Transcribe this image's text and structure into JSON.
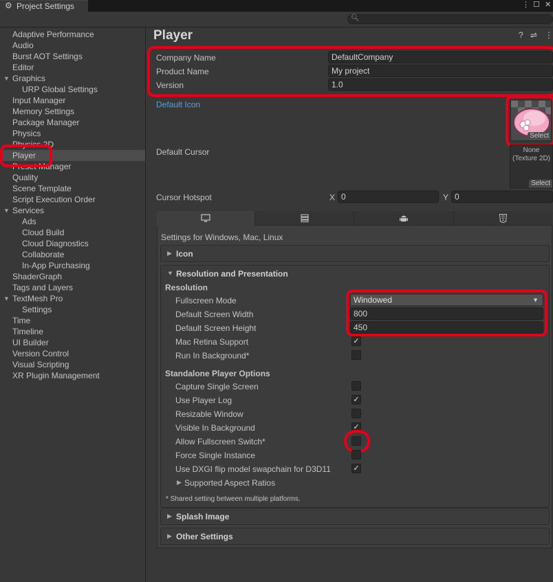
{
  "window": {
    "tab_label": "Project Settings",
    "tab_icon": "gear-icon",
    "menu_icon": "more-vert-icon",
    "maximize_icon": "maximize-icon",
    "close_icon": "close-icon"
  },
  "search": {
    "icon": "search-icon",
    "value": ""
  },
  "sidebar": {
    "items": [
      {
        "label": "Adaptive Performance"
      },
      {
        "label": "Audio"
      },
      {
        "label": "Burst AOT Settings"
      },
      {
        "label": "Editor"
      },
      {
        "label": "Graphics"
      },
      {
        "label": "URP Global Settings"
      },
      {
        "label": "Input Manager"
      },
      {
        "label": "Memory Settings"
      },
      {
        "label": "Package Manager"
      },
      {
        "label": "Physics"
      },
      {
        "label": "Physics 2D"
      },
      {
        "label": "Player"
      },
      {
        "label": "Preset Manager"
      },
      {
        "label": "Quality"
      },
      {
        "label": "Scene Template"
      },
      {
        "label": "Script Execution Order"
      },
      {
        "label": "Services"
      },
      {
        "label": "Ads"
      },
      {
        "label": "Cloud Build"
      },
      {
        "label": "Cloud Diagnostics"
      },
      {
        "label": "Collaborate"
      },
      {
        "label": "In-App Purchasing"
      },
      {
        "label": "ShaderGraph"
      },
      {
        "label": "Tags and Layers"
      },
      {
        "label": "TextMesh Pro"
      },
      {
        "label": "Settings"
      },
      {
        "label": "Time"
      },
      {
        "label": "Timeline"
      },
      {
        "label": "UI Builder"
      },
      {
        "label": "Version Control"
      },
      {
        "label": "Visual Scripting"
      },
      {
        "label": "XR Plugin Management"
      }
    ],
    "selected": "Player"
  },
  "header": {
    "title": "Player",
    "help_icon": "help-icon",
    "preset_icon": "sliders-icon",
    "menu_icon": "more-vert-icon"
  },
  "player": {
    "company_name_label": "Company Name",
    "company_name": "DefaultCompany",
    "product_name_label": "Product Name",
    "product_name": "My project",
    "version_label": "Version",
    "version": "1.0",
    "default_icon_label": "Default Icon",
    "select_label": "Select",
    "default_cursor_label": "Default Cursor",
    "cursor_none_line1": "None",
    "cursor_none_line2": "(Texture 2D)",
    "cursor_hotspot_label": "Cursor Hotspot",
    "x_label": "X",
    "x_value": "0",
    "y_label": "Y",
    "y_value": "0"
  },
  "platform_tabs": [
    {
      "icon": "monitor-icon"
    },
    {
      "icon": "server-icon"
    },
    {
      "icon": "android-icon"
    },
    {
      "icon": "html5-icon"
    }
  ],
  "platform": {
    "settings_for": "Settings for Windows, Mac, Linux",
    "icon_section": "Icon",
    "resolution_section": "Resolution and Presentation",
    "resolution_sub": "Resolution",
    "fullscreen_mode_label": "Fullscreen Mode",
    "fullscreen_mode": "Windowed",
    "screen_width_label": "Default Screen Width",
    "screen_width": "800",
    "screen_height_label": "Default Screen Height",
    "screen_height": "450",
    "mac_retina_label": "Mac Retina Support",
    "run_bg_label": "Run In Background*",
    "standalone_sub": "Standalone Player Options",
    "capture_single_label": "Capture Single Screen",
    "use_player_log_label": "Use Player Log",
    "resizable_label": "Resizable Window",
    "visible_bg_label": "Visible In Background",
    "allow_fullscreen_label": "Allow Fullscreen Switch*",
    "force_single_label": "Force Single Instance",
    "dxgi_label": "Use DXGI flip model swapchain for D3D11",
    "aspect_ratios_label": "Supported Aspect Ratios",
    "shared_note": "* Shared setting between multiple platforms.",
    "splash_section": "Splash Image",
    "other_section": "Other Settings",
    "checks": {
      "mac_retina": true,
      "run_bg": false,
      "capture_single": false,
      "use_player_log": true,
      "resizable": false,
      "visible_bg": true,
      "allow_fullscreen": false,
      "force_single": false,
      "dxgi": true
    },
    "check_glyph": "✓"
  },
  "colors": {
    "highlight": "#e3001b",
    "link": "#5f9ed8",
    "background": "#383838"
  }
}
